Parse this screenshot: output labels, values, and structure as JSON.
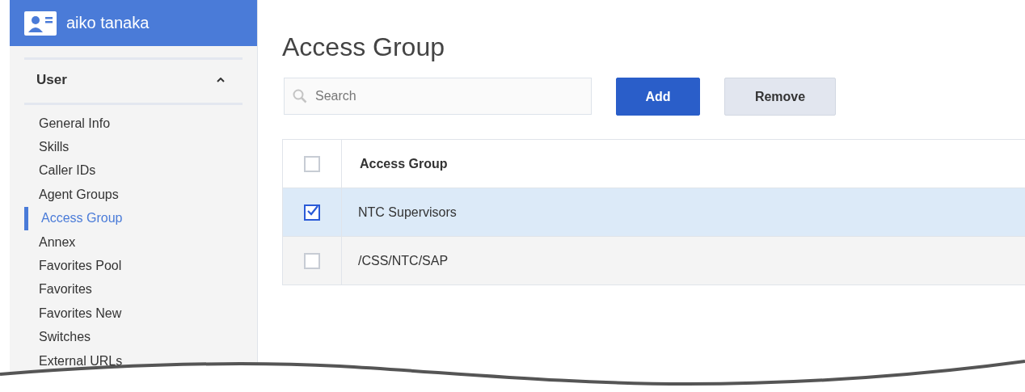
{
  "profile": {
    "name": "aiko tanaka"
  },
  "sidebar": {
    "section": {
      "title": "User",
      "expanded": true
    },
    "items": [
      {
        "label": "General Info",
        "selected": false
      },
      {
        "label": "Skills",
        "selected": false
      },
      {
        "label": "Caller IDs",
        "selected": false
      },
      {
        "label": "Agent Groups",
        "selected": false
      },
      {
        "label": "Access Group",
        "selected": true
      },
      {
        "label": "Annex",
        "selected": false
      },
      {
        "label": "Favorites Pool",
        "selected": false
      },
      {
        "label": "Favorites",
        "selected": false
      },
      {
        "label": "Favorites New",
        "selected": false
      },
      {
        "label": "Switches",
        "selected": false
      },
      {
        "label": "External URLs",
        "selected": false
      }
    ]
  },
  "page": {
    "title": "Access Group"
  },
  "search": {
    "placeholder": "Search"
  },
  "buttons": [
    {
      "label": "Add",
      "kind": "primary"
    },
    {
      "label": "Remove",
      "kind": "secondary"
    }
  ],
  "table": {
    "header": {
      "label": "Access Group",
      "checked": false
    },
    "rows": [
      {
        "label": "NTC Supervisors",
        "checked": true,
        "selected": true
      },
      {
        "label": "/CSS/NTC/SAP",
        "checked": false,
        "selected": false
      }
    ]
  }
}
